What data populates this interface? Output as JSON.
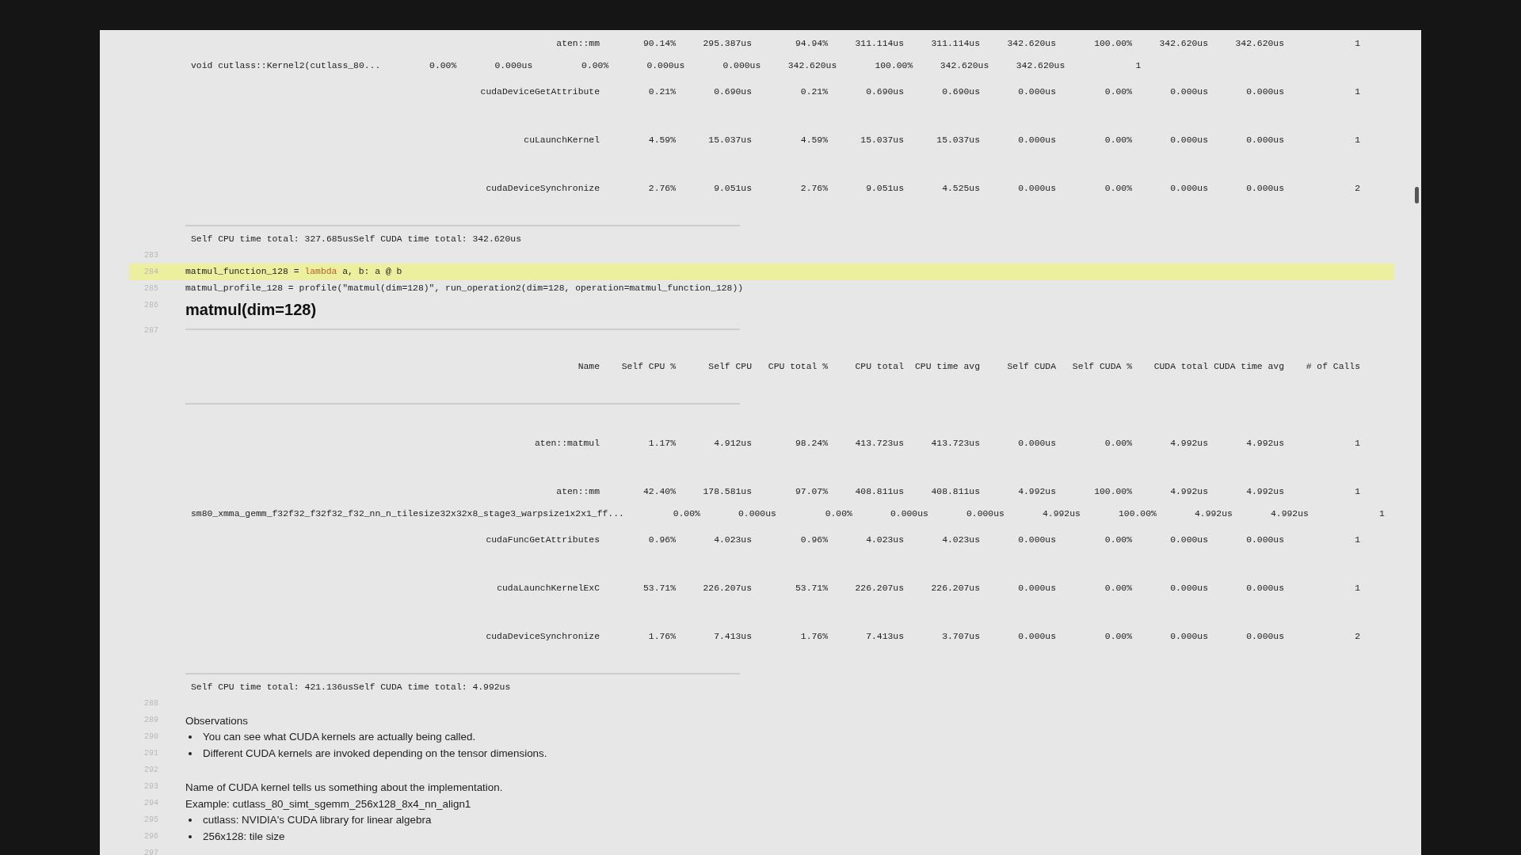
{
  "blocks": [
    {
      "kind": "profile",
      "rows": [
        {
          "kind": "op",
          "name": "aten::mm",
          "values": [
            "90.14%",
            "295.387us",
            "94.94%",
            "311.114us",
            "311.114us",
            "342.620us",
            "100.00%",
            "342.620us",
            "342.620us",
            "1"
          ]
        },
        {
          "kind": "kernel",
          "name": "void cutlass::Kernel2(cutlass_80...",
          "values": [
            "0.00%",
            "0.000us",
            "0.00%",
            "0.000us",
            "0.000us",
            "342.620us",
            "100.00%",
            "342.620us",
            "342.620us",
            "1"
          ]
        },
        {
          "kind": "op",
          "name": "cudaDeviceGetAttribute",
          "values": [
            "0.21%",
            "0.690us",
            "0.21%",
            "0.690us",
            "0.690us",
            "0.000us",
            "0.00%",
            "0.000us",
            "0.000us",
            "1"
          ]
        },
        {
          "kind": "op",
          "name": "cuLaunchKernel",
          "values": [
            "4.59%",
            "15.037us",
            "4.59%",
            "15.037us",
            "15.037us",
            "0.000us",
            "0.00%",
            "0.000us",
            "0.000us",
            "1"
          ]
        },
        {
          "kind": "op",
          "name": "cudaDeviceSynchronize",
          "values": [
            "2.76%",
            "9.051us",
            "2.76%",
            "9.051us",
            "4.525us",
            "0.000us",
            "0.00%",
            "0.000us",
            "0.000us",
            "2"
          ]
        }
      ],
      "summary": "Self CPU time total: 327.685usSelf CUDA time total: 342.620us"
    },
    {
      "kind": "blank",
      "number": "283"
    },
    {
      "kind": "code",
      "number": "284",
      "highlighted": true,
      "segments": [
        {
          "text": "matmul_function_128 = "
        },
        {
          "text": "lambda",
          "kind": "keyword"
        },
        {
          "text": " a, b: a @ b"
        }
      ]
    },
    {
      "kind": "code",
      "number": "285",
      "highlighted": false,
      "segments": [
        {
          "text": "matmul_profile_128 = profile(\"matmul(dim=128)\", run_operation2(dim=128, operation=matmul_function_128))"
        }
      ]
    },
    {
      "kind": "heading",
      "number": "286",
      "text": "matmul(dim=128)"
    },
    {
      "kind": "profile",
      "number": "287",
      "columns": [
        "Name",
        "Self CPU %",
        "Self CPU",
        "CPU total %",
        "CPU total",
        "CPU time avg",
        "Self CUDA",
        "Self CUDA %",
        "CUDA total",
        "CUDA time avg",
        "# of Calls"
      ],
      "rows": [
        {
          "kind": "op",
          "name": "aten::matmul",
          "values": [
            "1.17%",
            "4.912us",
            "98.24%",
            "413.723us",
            "413.723us",
            "0.000us",
            "0.00%",
            "4.992us",
            "4.992us",
            "1"
          ]
        },
        {
          "kind": "op",
          "name": "aten::mm",
          "values": [
            "42.40%",
            "178.581us",
            "97.07%",
            "408.811us",
            "408.811us",
            "4.992us",
            "100.00%",
            "4.992us",
            "4.992us",
            "1"
          ]
        },
        {
          "kind": "kernel",
          "name": "sm80_xmma_gemm_f32f32_f32f32_f32_nn_n_tilesize32x32x8_stage3_warpsize1x2x1_ff...",
          "values": [
            "0.00%",
            "0.000us",
            "0.00%",
            "0.000us",
            "0.000us",
            "4.992us",
            "100.00%",
            "4.992us",
            "4.992us",
            "1"
          ]
        },
        {
          "kind": "op",
          "name": "cudaFuncGetAttributes",
          "values": [
            "0.96%",
            "4.023us",
            "0.96%",
            "4.023us",
            "4.023us",
            "0.000us",
            "0.00%",
            "0.000us",
            "0.000us",
            "1"
          ]
        },
        {
          "kind": "op",
          "name": "cudaLaunchKernelExC",
          "values": [
            "53.71%",
            "226.207us",
            "53.71%",
            "226.207us",
            "226.207us",
            "0.000us",
            "0.00%",
            "0.000us",
            "0.000us",
            "1"
          ]
        },
        {
          "kind": "op",
          "name": "cudaDeviceSynchronize",
          "values": [
            "1.76%",
            "7.413us",
            "1.76%",
            "7.413us",
            "3.707us",
            "0.000us",
            "0.00%",
            "0.000us",
            "0.000us",
            "2"
          ]
        }
      ],
      "summary": "Self CPU time total: 421.136usSelf CUDA time total: 4.992us"
    },
    {
      "kind": "blank",
      "number": "288"
    },
    {
      "kind": "text",
      "number": "289",
      "text": "Observations"
    },
    {
      "kind": "bullet",
      "number": "290",
      "text": "You can see what CUDA kernels are actually being called."
    },
    {
      "kind": "bullet",
      "number": "291",
      "text": "Different CUDA kernels are invoked depending on the tensor dimensions."
    },
    {
      "kind": "blank",
      "number": "292"
    },
    {
      "kind": "text",
      "number": "293",
      "text": "Name of CUDA kernel tells us something about the implementation."
    },
    {
      "kind": "text",
      "number": "294",
      "text": "Example: cutlass_80_simt_sgemm_256x128_8x4_nn_align1"
    },
    {
      "kind": "bullet",
      "number": "295",
      "text": "cutlass: NVIDIA's CUDA library for linear algebra"
    },
    {
      "kind": "bullet",
      "number": "296",
      "text": "256x128: tile size"
    },
    {
      "kind": "blank",
      "number": "297"
    }
  ]
}
